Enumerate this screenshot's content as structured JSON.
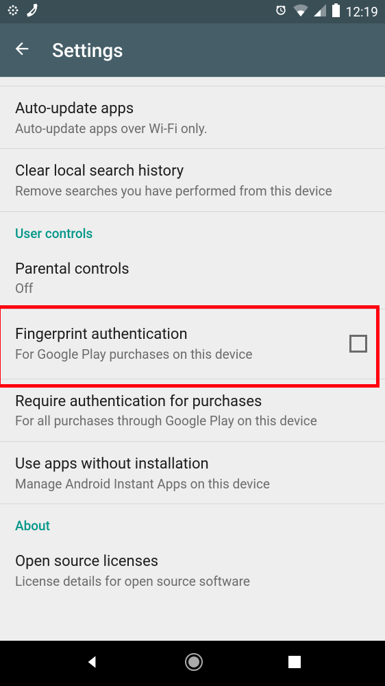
{
  "statusbar": {
    "time": "12:19"
  },
  "appbar": {
    "title": "Settings"
  },
  "items": {
    "auto_update": {
      "title": "Auto-update apps",
      "subtitle": "Auto-update apps over Wi-Fi only."
    },
    "clear_history": {
      "title": "Clear local search history",
      "subtitle": "Remove searches you have performed from this device"
    }
  },
  "sections": {
    "user_controls": "User controls",
    "about": "About"
  },
  "user_controls": {
    "parental": {
      "title": "Parental controls",
      "subtitle": "Off"
    },
    "fingerprint": {
      "title": "Fingerprint authentication",
      "subtitle": "For Google Play purchases on this device"
    },
    "require_auth": {
      "title": "Require authentication for purchases",
      "subtitle": "For all purchases through Google Play on this device"
    },
    "instant_apps": {
      "title": "Use apps without installation",
      "subtitle": "Manage Android Instant Apps on this device"
    }
  },
  "about": {
    "licenses": {
      "title": "Open source licenses",
      "subtitle": "License details for open source software"
    }
  }
}
